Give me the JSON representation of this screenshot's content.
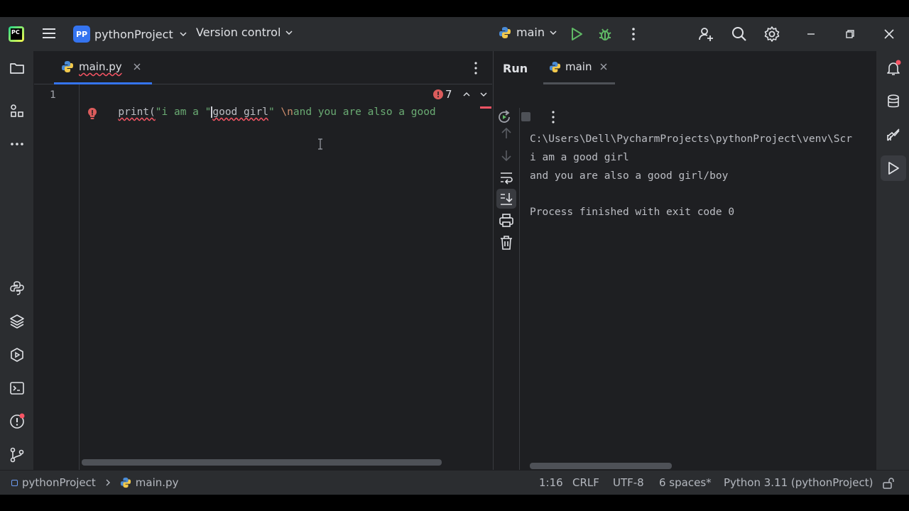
{
  "titlebar": {
    "app_icon": "pycharm-logo",
    "project_badge": "PP",
    "project_name": "pythonProject",
    "vcs_label": "Version control",
    "run_config": "main"
  },
  "editor": {
    "tab_label": "main.py",
    "line_number": "1",
    "code": {
      "p1": "print(",
      "p2": "\"i am a \"",
      "p3": "good girl",
      "p4": "\"",
      "p5": " \\n",
      "p6": "and you are also a good"
    },
    "problems_count": "7",
    "error_bulb_icon": "error-bulb-icon"
  },
  "run_panel": {
    "tab_run": "Run",
    "tab_config": "main",
    "output": [
      "C:\\Users\\Dell\\PycharmProjects\\pythonProject\\venv\\Scr",
      "i am a good girl",
      "and you are also a good girl/boy",
      "",
      "Process finished with exit code 0"
    ]
  },
  "statusbar": {
    "breadcrumb_project": "pythonProject",
    "breadcrumb_file": "main.py",
    "caret": "1:16",
    "line_sep": "CRLF",
    "encoding": "UTF-8",
    "indent": "6 spaces*",
    "interpreter": "Python 3.11 (pythonProject)"
  },
  "colors": {
    "accent": "#3574f0",
    "run_green": "#5fb865",
    "error_red": "#f75464"
  }
}
